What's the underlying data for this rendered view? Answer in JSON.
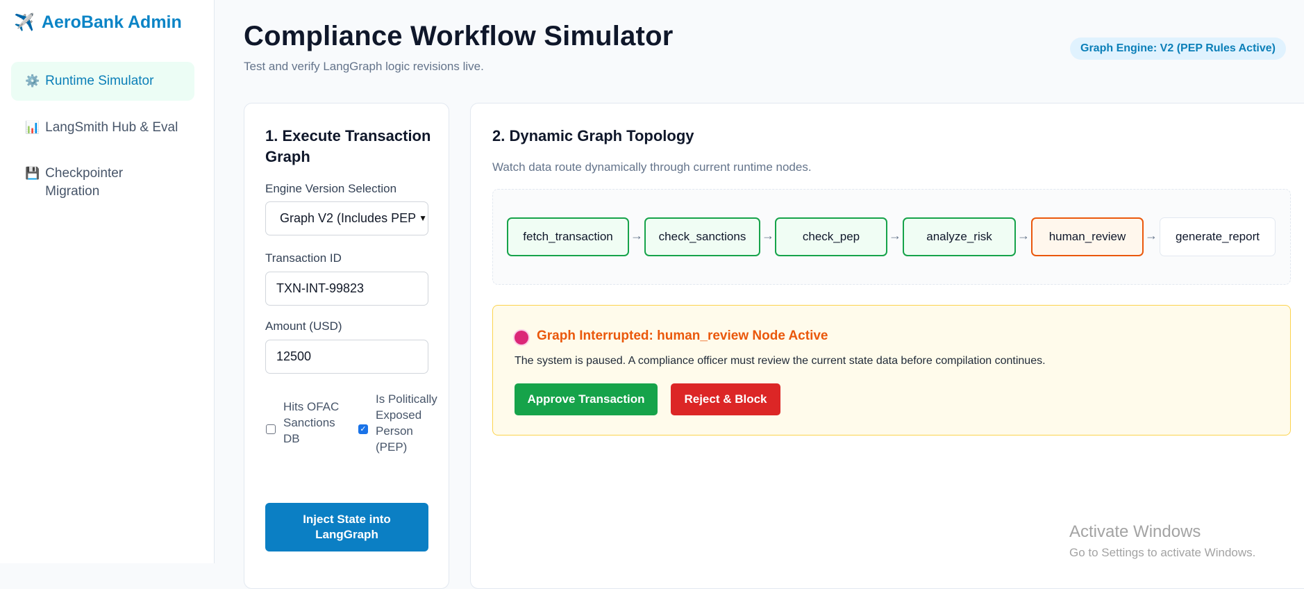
{
  "sidebar": {
    "brand": {
      "icon": "airplane-icon",
      "glyph": "✈️",
      "label": "AeroBank Admin"
    },
    "items": [
      {
        "icon": "gear-icon",
        "glyph": "⚙️",
        "label": "Runtime Simulator",
        "active": true
      },
      {
        "icon": "bar-chart-icon",
        "glyph": "📊",
        "label": "LangSmith Hub & Eval",
        "active": false
      },
      {
        "icon": "floppy-disk-icon",
        "glyph": "💾",
        "label": "Checkpointer Migration",
        "active": false
      }
    ]
  },
  "header": {
    "title": "Compliance Workflow Simulator",
    "subtitle": "Test and verify LangGraph logic revisions live.",
    "engine_badge": "Graph Engine: V2 (PEP Rules Active)"
  },
  "execute_panel": {
    "title": "1. Execute Transaction Graph",
    "engine_label": "Engine Version Selection",
    "engine_value": "Graph V2 (Includes PEP",
    "txn_label": "Transaction ID",
    "txn_value": "TXN-INT-99823",
    "amount_label": "Amount (USD)",
    "amount_value": "12500",
    "ofac_label": "Hits OFAC Sanctions DB",
    "ofac_checked": false,
    "pep_label": "Is Politically Exposed Person (PEP)",
    "pep_checked": true,
    "inject_label": "Inject State into LangGraph"
  },
  "topology_panel": {
    "title": "2. Dynamic Graph Topology",
    "subtitle": "Watch data route dynamically through current runtime nodes.",
    "arrow": "→",
    "nodes": [
      {
        "label": "fetch_transaction",
        "status": "complete"
      },
      {
        "label": "check_sanctions",
        "status": "complete"
      },
      {
        "label": "check_pep",
        "status": "complete"
      },
      {
        "label": "analyze_risk",
        "status": "complete"
      },
      {
        "label": "human_review",
        "status": "active"
      },
      {
        "label": "generate_report",
        "status": "pending"
      }
    ]
  },
  "interrupt": {
    "title": "Graph Interrupted: human_review Node Active",
    "message": "The system is paused. A compliance officer must review the current state data before compilation continues.",
    "approve_label": "Approve Transaction",
    "reject_label": "Reject & Block"
  },
  "watermark": {
    "line1": "Activate Windows",
    "line2": "Go to Settings to activate Windows."
  },
  "colors": {
    "brand": "#0b84c6",
    "complete": "#16a34a",
    "active": "#ea580c",
    "danger": "#dc2626"
  }
}
